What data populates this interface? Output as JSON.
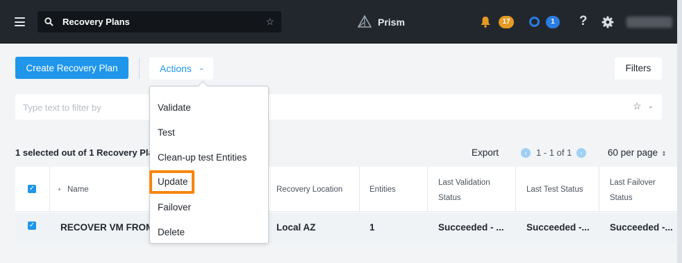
{
  "header": {
    "search_query": "Recovery Plans",
    "app_name": "Prism",
    "alerts_count": "17",
    "tasks_count": "1",
    "help_label": "?",
    "accent_color": "#1f96ea",
    "alert_color": "#e59a24"
  },
  "toolbar": {
    "create_label": "Create Recovery Plan",
    "actions_label": "Actions",
    "filters_label": "Filters"
  },
  "filter": {
    "placeholder": "Type text to filter by"
  },
  "summary": {
    "selection_text": "1 selected out of 1 Recovery Pla",
    "export_label": "Export",
    "pagination": "1 - 1 of 1",
    "per_page": "60 per page"
  },
  "actions_menu": {
    "items": [
      "Validate",
      "Test",
      "Clean-up test Entities",
      "Update",
      "Failover",
      "Delete"
    ],
    "highlighted": "Update"
  },
  "table": {
    "columns": [
      "Name",
      "Recovery Location",
      "Entities",
      "Last Validation Status",
      "Last Test Status",
      "Last Failover Status"
    ],
    "columns_display": {
      "last_validation_1": "Last Validation",
      "last_validation_2": "Status",
      "last_failover_1": "Last Failover",
      "last_failover_2": "Status"
    },
    "rows": [
      {
        "selected": true,
        "name": "RECOVER VM FROM",
        "recovery_location": "Local AZ",
        "entities": "1",
        "last_validation_status": "Succeeded - ...",
        "last_test_status": "Succeeded -...",
        "last_failover_status": "Succeeded -..."
      }
    ]
  }
}
